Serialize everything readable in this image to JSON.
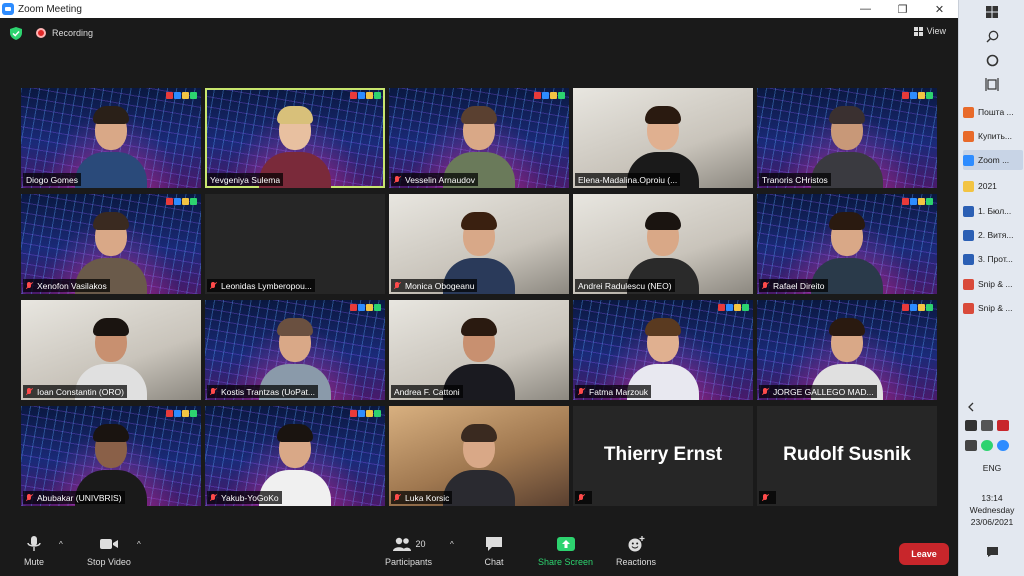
{
  "window": {
    "title": "Zoom Meeting",
    "controls": [
      "—",
      "❐",
      "✕"
    ]
  },
  "infobar": {
    "recording_label": "Recording",
    "view_label": "View"
  },
  "participants": [
    {
      "name": "Diogo Gomes",
      "bg": "net",
      "muted": false,
      "logo": true,
      "skin": "#d9a887",
      "hair": "#2a2018",
      "shirt": "#2a4a7a"
    },
    {
      "name": "Yevgeniya Sulema",
      "bg": "net",
      "muted": false,
      "logo": true,
      "active": true,
      "skin": "#e8c0a0",
      "hair": "#d8c07a",
      "shirt": "#7a2a3a"
    },
    {
      "name": "Vesselin Arnaudov",
      "bg": "net",
      "muted": true,
      "logo": true,
      "skin": "#d9a887",
      "hair": "#5a4030",
      "shirt": "#6a7a5a"
    },
    {
      "name": "Elena-Madalina.Oproiu (...",
      "bg": "room",
      "muted": false,
      "logo": false,
      "skin": "#e0b090",
      "hair": "#2a1a10",
      "shirt": "#1a1a1a"
    },
    {
      "name": "Tranoris CHristos",
      "bg": "net",
      "muted": false,
      "logo": true,
      "skin": "#c89878",
      "hair": "#3a3030",
      "shirt": "#3a3a40"
    },
    {
      "name": "Xenofon Vasilakos",
      "bg": "net",
      "muted": true,
      "logo": true,
      "skin": "#d9a887",
      "hair": "#3a2a20",
      "shirt": "#6a5a4a"
    },
    {
      "name": "Leonidas Lymberopou...",
      "bg": "blank",
      "muted": true,
      "logo": false
    },
    {
      "name": "Monica Obogeanu",
      "bg": "room",
      "muted": true,
      "logo": false,
      "skin": "#d8a888",
      "hair": "#3a2010",
      "shirt": "#2a3a5a"
    },
    {
      "name": "Andrei Radulescu (NEO)",
      "bg": "room",
      "muted": false,
      "logo": false,
      "skin": "#d9a887",
      "hair": "#1a1410",
      "shirt": "#2a2a2a"
    },
    {
      "name": "Rafael Direito",
      "bg": "net",
      "muted": true,
      "logo": true,
      "skin": "#d9a887",
      "hair": "#2a1a10",
      "shirt": "#2a3a4a"
    },
    {
      "name": "Ioan Constantin (ORO)",
      "bg": "room",
      "muted": true,
      "logo": false,
      "skin": "#c89070",
      "hair": "#1a1410",
      "shirt": "#e0e0e0"
    },
    {
      "name": "Kostis Trantzas (UoPat...",
      "bg": "net",
      "muted": true,
      "logo": true,
      "skin": "#d9a887",
      "hair": "#6a5040",
      "shirt": "#8a9aaa"
    },
    {
      "name": "Andrea F. Cattoni",
      "bg": "room",
      "muted": false,
      "logo": false,
      "skin": "#c89070",
      "hair": "#2a1a10",
      "shirt": "#1a1a20"
    },
    {
      "name": "Fatma Marzouk",
      "bg": "net",
      "muted": true,
      "logo": true,
      "skin": "#e0b090",
      "hair": "#5a3a20",
      "shirt": "#e8e8f0"
    },
    {
      "name": "JORGE GALLEGO MAD...",
      "bg": "net",
      "muted": true,
      "logo": true,
      "skin": "#d9a887",
      "hair": "#2a1a10",
      "shirt": "#e0e0e0"
    },
    {
      "name": "Abubakar (UNIVBRIS)",
      "bg": "net",
      "muted": true,
      "logo": true,
      "skin": "#8a6048",
      "hair": "#1a1410",
      "shirt": "#1a1a1a"
    },
    {
      "name": "Yakub-YoGoKo",
      "bg": "net",
      "muted": true,
      "logo": true,
      "skin": "#d9a887",
      "hair": "#1a1410",
      "shirt": "#f0f0f0"
    },
    {
      "name": "Luka Korsic",
      "bg": "warm",
      "muted": true,
      "logo": false,
      "skin": "#d9a887",
      "hair": "#3a2a20",
      "shirt": "#2a2a30"
    },
    {
      "name": "Thierry Ernst",
      "bg": "blank",
      "muted": true,
      "logo": false,
      "bigname": true,
      "hide_bar_name": true
    },
    {
      "name": "Rudolf Susnik",
      "bg": "blank",
      "muted": true,
      "logo": false,
      "bigname": true,
      "hide_bar_name": true
    }
  ],
  "toolbar": {
    "mute_label": "Mute",
    "video_label": "Stop Video",
    "participants_label": "Participants",
    "participants_count": "20",
    "chat_label": "Chat",
    "share_label": "Share Screen",
    "reactions_label": "Reactions",
    "leave_label": "Leave"
  },
  "taskbar": {
    "items": [
      {
        "label": "Пошта ...",
        "color": "#e86a2a"
      },
      {
        "label": "Купить...",
        "color": "#e86a2a"
      },
      {
        "label": "Zoom ...",
        "color": "#2d8cff",
        "active": true
      },
      {
        "label": "2021",
        "color": "#f2c443"
      },
      {
        "label": "1. Бюл...",
        "color": "#2b5fb4"
      },
      {
        "label": "2. Витя...",
        "color": "#2b5fb4"
      },
      {
        "label": "3. Прот...",
        "color": "#2b5fb4"
      },
      {
        "label": "Snip & ...",
        "color": "#d94a3a"
      },
      {
        "label": "Snip & ...",
        "color": "#d94a3a"
      }
    ],
    "language": "ENG",
    "time": "13:14",
    "day": "Wednesday",
    "date": "23/06/2021"
  },
  "colors": {
    "accent": "#2d8cff",
    "leave": "#c8262b",
    "share_green": "#2dd36f",
    "active_speaker": "#c8e66e",
    "muted_red": "#ff4b4b"
  }
}
